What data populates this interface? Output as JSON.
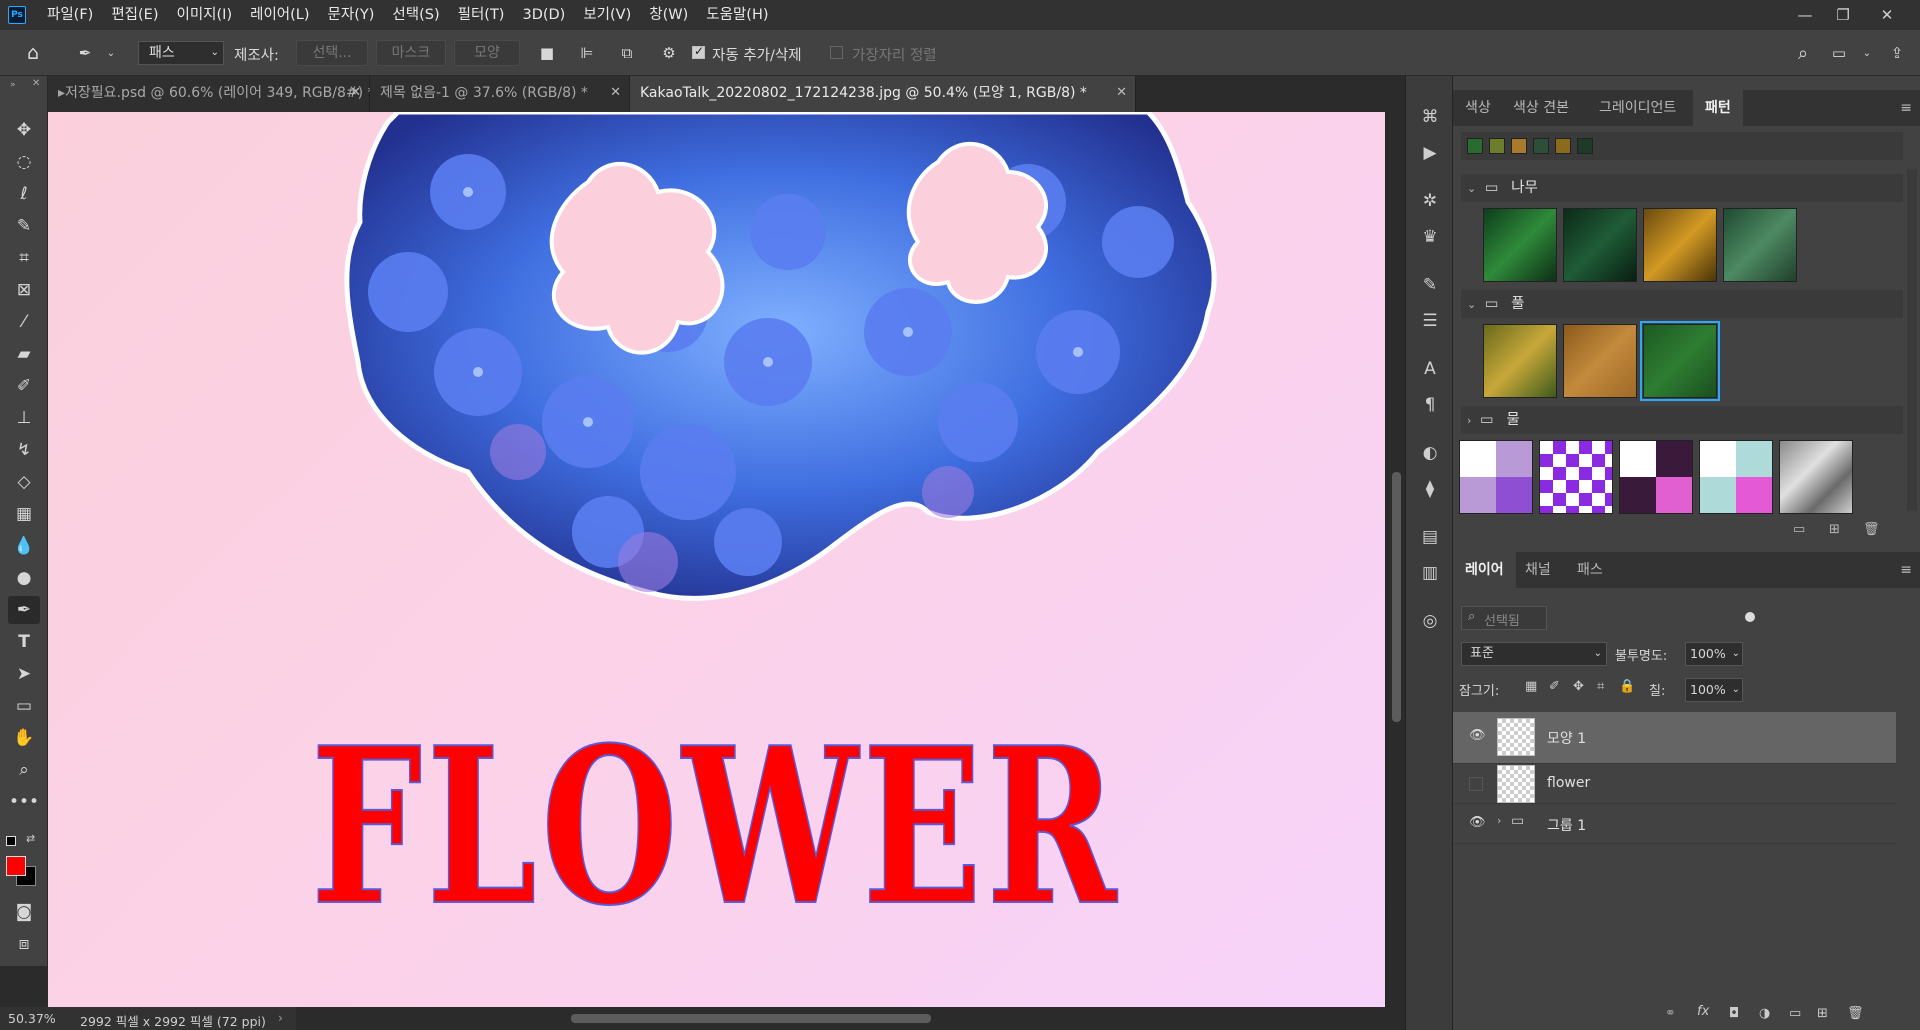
{
  "menu": {
    "logo": "Ps",
    "items": [
      "파일(F)",
      "편집(E)",
      "이미지(I)",
      "레이어(L)",
      "문자(Y)",
      "선택(S)",
      "필터(T)",
      "3D(D)",
      "보기(V)",
      "창(W)",
      "도움말(H)"
    ],
    "window_controls": [
      "minimize-icon",
      "restore-icon",
      "close-icon"
    ]
  },
  "options": {
    "tool_mode": "패스",
    "make_label": "제조사:",
    "selection_btn": "선택...",
    "mask_btn": "마스크",
    "shape_btn": "모양",
    "auto_add_delete": "자동 추가/삭제",
    "auto_add_delete_checked": true,
    "align_edges": "가장자리 정렬",
    "align_edges_checked": false
  },
  "tabs": [
    {
      "label": "▸저장필요.psd @ 60.6% (레이어 349, RGB/8#) *",
      "active": false
    },
    {
      "label": "제목 없음-1 @ 37.6% (RGB/8) *",
      "active": false
    },
    {
      "label": "KakaoTalk_20220802_172124238.jpg @ 50.4% (모양 1, RGB/8) *",
      "active": true
    }
  ],
  "canvas": {
    "text": "FLOWER",
    "text_color": "#ff0000",
    "bg_colors": [
      "#fbd0dc",
      "#f7d3fb"
    ]
  },
  "status": {
    "zoom": "50.37%",
    "doc_size": "2992 픽셀 x 2992 픽셀 (72 ppi)"
  },
  "patterns_panel": {
    "tabs": [
      "색상",
      "색상 견본",
      "그레이디언트",
      "패턴"
    ],
    "active_tab": "패턴",
    "groups": [
      {
        "name": "나무",
        "expanded": true
      },
      {
        "name": "풀",
        "expanded": true
      },
      {
        "name": "물",
        "expanded": false
      }
    ]
  },
  "layers_panel": {
    "tabs": [
      "레이어",
      "채널",
      "패스"
    ],
    "active_tab": "레이어",
    "filter_placeholder": "선택됨",
    "blend_mode": "표준",
    "opacity_label": "불투명도:",
    "opacity": "100%",
    "lock_label": "잠그기:",
    "fill_label": "칠:",
    "fill": "100%",
    "layers": [
      {
        "name": "모양 1",
        "visible": true,
        "selected": true
      },
      {
        "name": "flower",
        "visible": false,
        "selected": false
      },
      {
        "name": "그룹 1",
        "visible": true,
        "selected": false
      }
    ]
  },
  "colors": {
    "foreground": "#ff0000",
    "background": "#000000",
    "accent": "#29a8ff"
  }
}
